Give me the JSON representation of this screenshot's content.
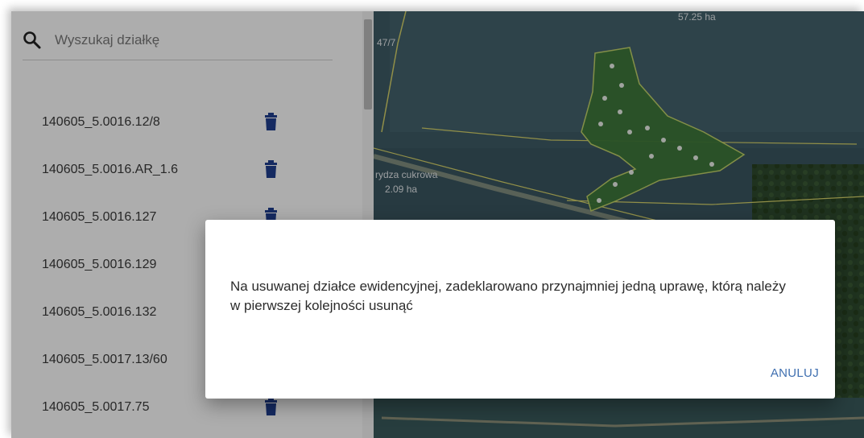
{
  "search": {
    "placeholder": "Wyszukaj działkę",
    "icon": "search-icon"
  },
  "parcels": [
    {
      "label": "140605_5.0016.12/8"
    },
    {
      "label": "140605_5.0016.AR_1.6"
    },
    {
      "label": "140605_5.0016.127"
    },
    {
      "label": "140605_5.0016.129"
    },
    {
      "label": "140605_5.0016.132"
    },
    {
      "label": "140605_5.0017.13/60"
    },
    {
      "label": "140605_5.0017.75"
    }
  ],
  "map": {
    "labels": {
      "area_top": "57.25 ha",
      "parcel_left": "47/7",
      "crop_name": "Burak ćwikłowy / rydza cukrowa",
      "crop_name_visible": "rydza cukrowa",
      "crop_area": "2.09 ha"
    }
  },
  "dialog": {
    "message": "Na usuwanej działce ewidencyjnej, zadeklarowano przynajmniej jedną uprawę, którą należy w pierwszej kolejności usunąć",
    "cancel_label": "ANULUJ"
  },
  "colors": {
    "accent": "#3f6fb0",
    "trash_icon": "#1f3f8f",
    "dialog_bg": "#ffffff"
  }
}
